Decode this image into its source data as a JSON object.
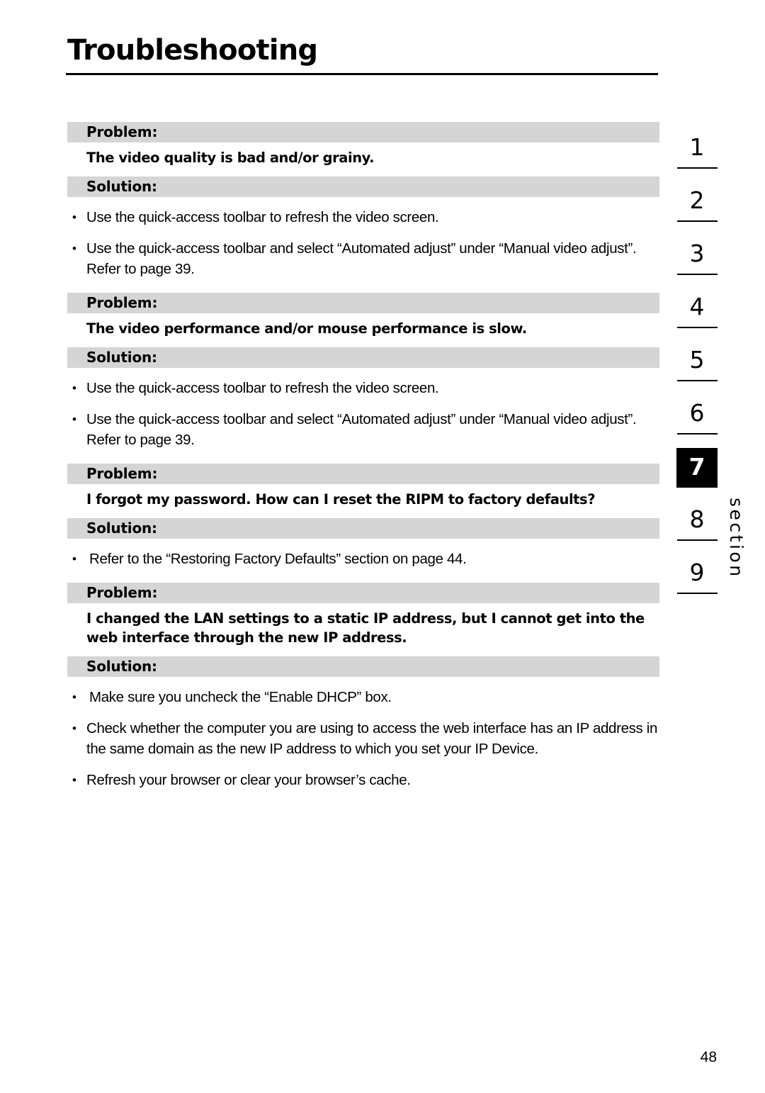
{
  "document": {
    "title": "Troubleshooting",
    "page_number": "48"
  },
  "labels": {
    "problem": "Problem:",
    "solution": "Solution:",
    "bullet_glyph": "•"
  },
  "blocks": [
    {
      "problem_label": "Problem:",
      "problem_text": "The video quality is bad and/or grainy.",
      "solution_label": "Solution:",
      "solutions": [
        "Use the quick-access toolbar to refresh the video screen.",
        "Use the quick-access toolbar and select “Automated adjust” under “Manual video adjust”. Refer to page 39."
      ]
    },
    {
      "problem_label": "Problem:",
      "problem_text": "The video performance and/or mouse performance is slow.",
      "solution_label": "Solution:",
      "solutions": [
        "Use the quick-access toolbar to refresh the video screen.",
        "Use the quick-access toolbar and select “Automated adjust” under “Manual video adjust”. Refer to page 39."
      ]
    },
    {
      "problem_label": "Problem:",
      "problem_text": "I forgot my password. How can I reset the RIPM to factory defaults?",
      "solution_label": "Solution:",
      "solutions": [
        "Refer to the “Restoring Factory Defaults” section on page 44."
      ]
    },
    {
      "problem_label": "Problem:",
      "problem_text": "I changed the LAN settings to a static IP address, but I cannot get into the web interface through the new IP address.",
      "solution_label": "Solution:",
      "solutions": [
        "Make sure you uncheck the “Enable DHCP” box.",
        "Check whether the computer you are using to access the web interface has an IP address in the same domain as the new IP address to which you set your IP Device.",
        "Refresh your browser or clear your browser’s cache."
      ]
    }
  ],
  "section_tabs": {
    "word": "section",
    "active": "7",
    "items": [
      {
        "number": "1",
        "active": false
      },
      {
        "number": "2",
        "active": false
      },
      {
        "number": "3",
        "active": false
      },
      {
        "number": "4",
        "active": false
      },
      {
        "number": "5",
        "active": false
      },
      {
        "number": "6",
        "active": false
      },
      {
        "number": "7",
        "active": true
      },
      {
        "number": "8",
        "active": false
      },
      {
        "number": "9",
        "active": false
      }
    ]
  },
  "colors": {
    "bar_background": "#d5d5d5",
    "active_tab_background": "#000000",
    "active_tab_text": "#ffffff",
    "text": "#000000",
    "page_background": "#ffffff"
  }
}
